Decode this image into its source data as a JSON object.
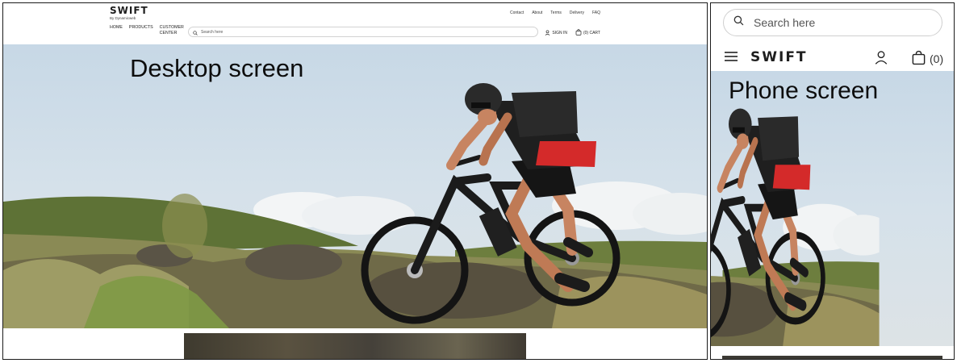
{
  "desktop": {
    "label": "Desktop screen",
    "logo": {
      "word": "SWIFT",
      "subtitle": "By Dynamicweb"
    },
    "utility_nav": [
      "Contact",
      "About",
      "Terms",
      "Delivery",
      "FAQ"
    ],
    "main_nav": [
      "HOME",
      "PRODUCTS",
      "CUSTOMER CENTER"
    ],
    "search": {
      "placeholder": "Search here",
      "value": ""
    },
    "sign_in": "SIGN IN",
    "cart": "(0) CART"
  },
  "phone": {
    "label": "Phone screen",
    "logo": {
      "word": "SWIFT"
    },
    "search": {
      "placeholder": "Search here",
      "value": ""
    },
    "cart_count": "(0)"
  },
  "icons": {
    "search": "search-icon",
    "user": "user-icon",
    "cart": "shopping-bag-icon",
    "menu": "hamburger-menu-icon"
  },
  "colors": {
    "text": "#1e1e1e",
    "border": "#d2d2d2",
    "sky": "#c7d8e6",
    "grass": "#6f7d3e",
    "jersey_red": "#d42a2a"
  }
}
